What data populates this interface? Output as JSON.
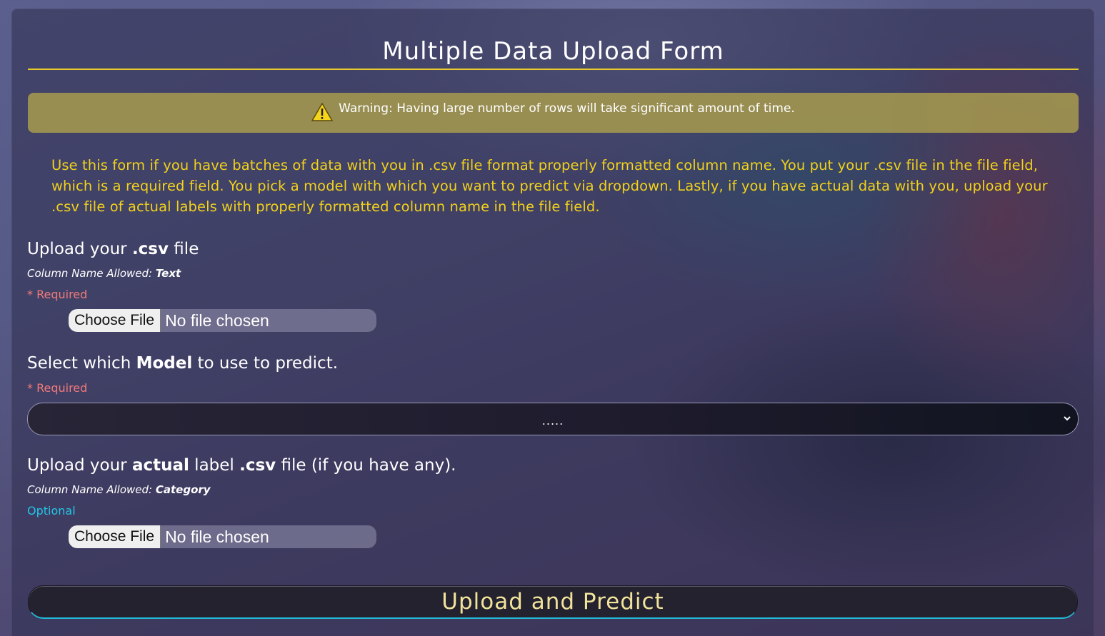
{
  "form": {
    "title": "Multiple Data Upload Form",
    "warning": {
      "icon": "warning-triangle-icon",
      "text": "Warning: Having large number of rows will take significant amount of time."
    },
    "intro": "Use this form if you have batches of data with you in .csv file format properly formatted column name. You put your .csv file in the file field, which is a required field. You pick a model with which you want to predict via dropdown. Lastly, if you have actual data with you, upload your .csv file of actual labels with properly formatted column name in the file field.",
    "csv_upload": {
      "label_pre": "Upload your ",
      "label_bold": ".csv",
      "label_post": " file",
      "hint_pre": "Column Name Allowed: ",
      "hint_value": "Text",
      "required": "* Required",
      "button": "Choose File",
      "status": "No file chosen"
    },
    "model_select": {
      "label_pre": "Select which ",
      "label_bold": "Model",
      "label_post": " to use to predict.",
      "required": "* Required",
      "selected": ".....",
      "chevron_icon": "chevron-down-icon"
    },
    "actual_upload": {
      "label_pre": "Upload your ",
      "label_bold1": "actual",
      "label_mid": " label ",
      "label_bold2": ".csv",
      "label_post": " file (if you have any).",
      "hint_pre": "Column Name Allowed: ",
      "hint_value": "Category",
      "optional": "Optional",
      "button": "Choose File",
      "status": "No file chosen"
    },
    "submit_label": "Upload and Predict"
  },
  "colors": {
    "accent_yellow": "#e8cc2a",
    "intro_text": "#f1d11a",
    "required_red": "#f07a7a",
    "optional_cyan": "#23c6e6",
    "submit_text": "#f1e39a"
  }
}
